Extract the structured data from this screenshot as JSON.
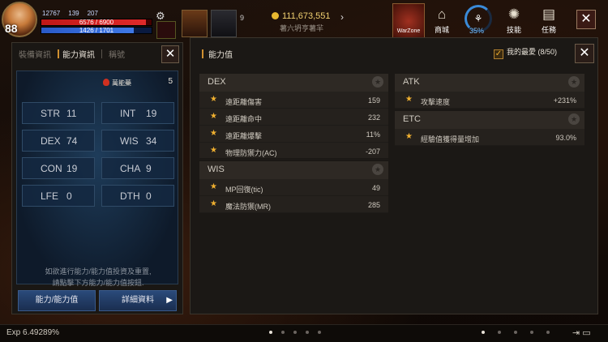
{
  "hud": {
    "level": "88",
    "stats_small": [
      "12767",
      "139",
      "207"
    ],
    "hp": "6576 / 6900",
    "mp": "1426 / 1701",
    "slot_count": "9",
    "gold": "111,673,551",
    "gold_sub": "薯六坍亨薯羋",
    "warzone": "WarZone",
    "buttons": [
      {
        "label": "商城",
        "icon": "shop-icon"
      },
      {
        "label": "技能",
        "icon": "skill-icon"
      },
      {
        "label": "任務",
        "icon": "quest-icon"
      }
    ],
    "progress_pct": "35%",
    "close": "✕"
  },
  "left_panel": {
    "tabs": [
      "裝備資訊",
      "能力資訊",
      "稱號"
    ],
    "active_tab": 1,
    "elixir_label": "萬能藥",
    "elixir_count": "5",
    "stats": [
      {
        "key": "STR",
        "value": "11"
      },
      {
        "key": "INT",
        "value": "19"
      },
      {
        "key": "DEX",
        "value": "74"
      },
      {
        "key": "WIS",
        "value": "34"
      },
      {
        "key": "CON",
        "value": "19"
      },
      {
        "key": "CHA",
        "value": "9"
      },
      {
        "key": "LFE",
        "value": "0"
      },
      {
        "key": "DTH",
        "value": "0"
      }
    ],
    "hint_line1": "如欲進行能力/能力值投資及重置,",
    "hint_line2": "請點擊下方能力/能力值按鈕.",
    "btn_ability": "能力/能力值",
    "btn_detail": "詳細資料",
    "close": "✕"
  },
  "right_panel": {
    "title": "能力值",
    "favorites": "我的最愛 (8/50)",
    "close": "✕",
    "groups": [
      {
        "name": "DEX",
        "rows": [
          {
            "label": "遠距離傷害",
            "value": "159"
          },
          {
            "label": "遠距離命中",
            "value": "232"
          },
          {
            "label": "遠距離爆擊",
            "value": "11%"
          },
          {
            "label": "物理防禦力(AC)",
            "value": "-207"
          }
        ]
      },
      {
        "name": "WIS",
        "rows": [
          {
            "label": "MP回復(tic)",
            "value": "49"
          },
          {
            "label": "魔法防禦(MR)",
            "value": "285"
          }
        ]
      },
      {
        "name": "ATK",
        "rows": [
          {
            "label": "攻擊速度",
            "value": "+231%"
          }
        ]
      },
      {
        "name": "ETC",
        "rows": [
          {
            "label": "經驗值獲得量增加",
            "value": "93.0%"
          }
        ]
      }
    ]
  },
  "bottom": {
    "exp": "Exp 6.49289%"
  }
}
